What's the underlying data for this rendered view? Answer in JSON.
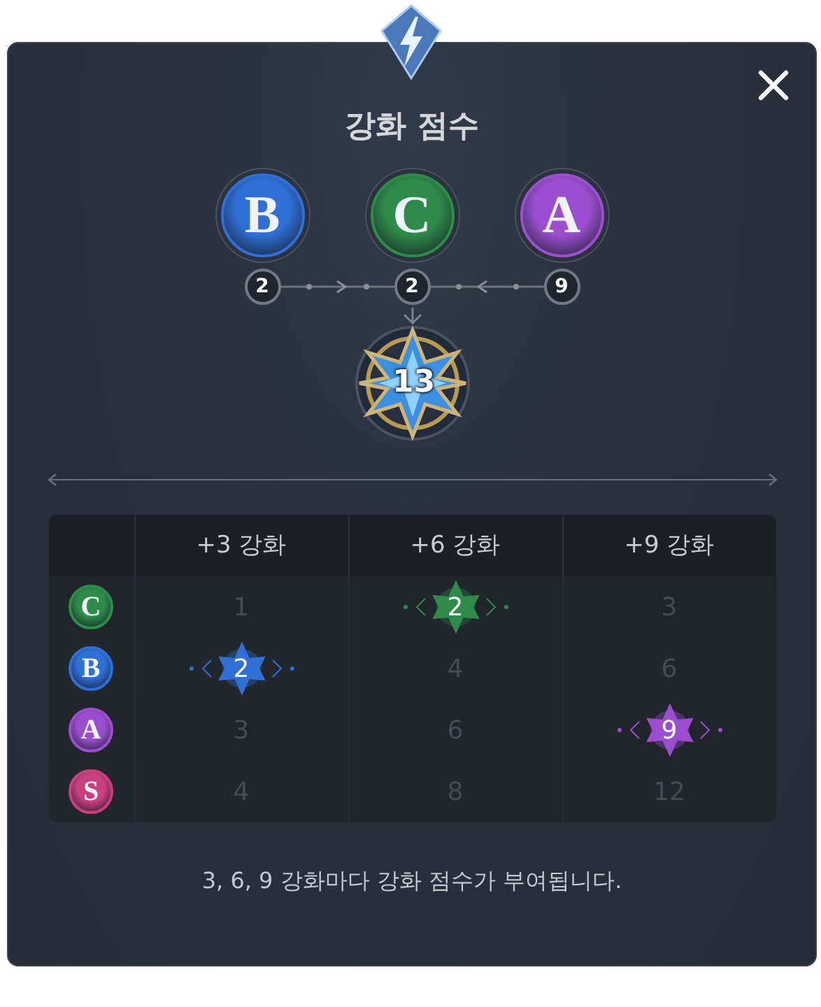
{
  "title": "강화 점수",
  "grades": [
    {
      "letter": "B",
      "color": "#2f6fd6",
      "score": "2"
    },
    {
      "letter": "C",
      "color": "#2e8b4a",
      "score": "2"
    },
    {
      "letter": "A",
      "color": "#9b4fd0",
      "score": "9"
    }
  ],
  "total": "13",
  "table": {
    "columns": [
      "+3 강화",
      "+6 강화",
      "+9 강화"
    ],
    "rows": [
      {
        "letter": "C",
        "color": "#2e8b4a",
        "cells": [
          {
            "value": "1",
            "selected": false
          },
          {
            "value": "2",
            "selected": true
          },
          {
            "value": "3",
            "selected": false
          }
        ]
      },
      {
        "letter": "B",
        "color": "#2f6fd6",
        "cells": [
          {
            "value": "2",
            "selected": true
          },
          {
            "value": "4",
            "selected": false
          },
          {
            "value": "6",
            "selected": false
          }
        ]
      },
      {
        "letter": "A",
        "color": "#9b4fd0",
        "cells": [
          {
            "value": "3",
            "selected": false
          },
          {
            "value": "6",
            "selected": false
          },
          {
            "value": "9",
            "selected": true
          }
        ]
      },
      {
        "letter": "S",
        "color": "#c8407e",
        "cells": [
          {
            "value": "4",
            "selected": false
          },
          {
            "value": "8",
            "selected": false
          },
          {
            "value": "12",
            "selected": false
          }
        ]
      }
    ]
  },
  "footnote": "3, 6, 9 강화마다 강화 점수가 부여됩니다."
}
